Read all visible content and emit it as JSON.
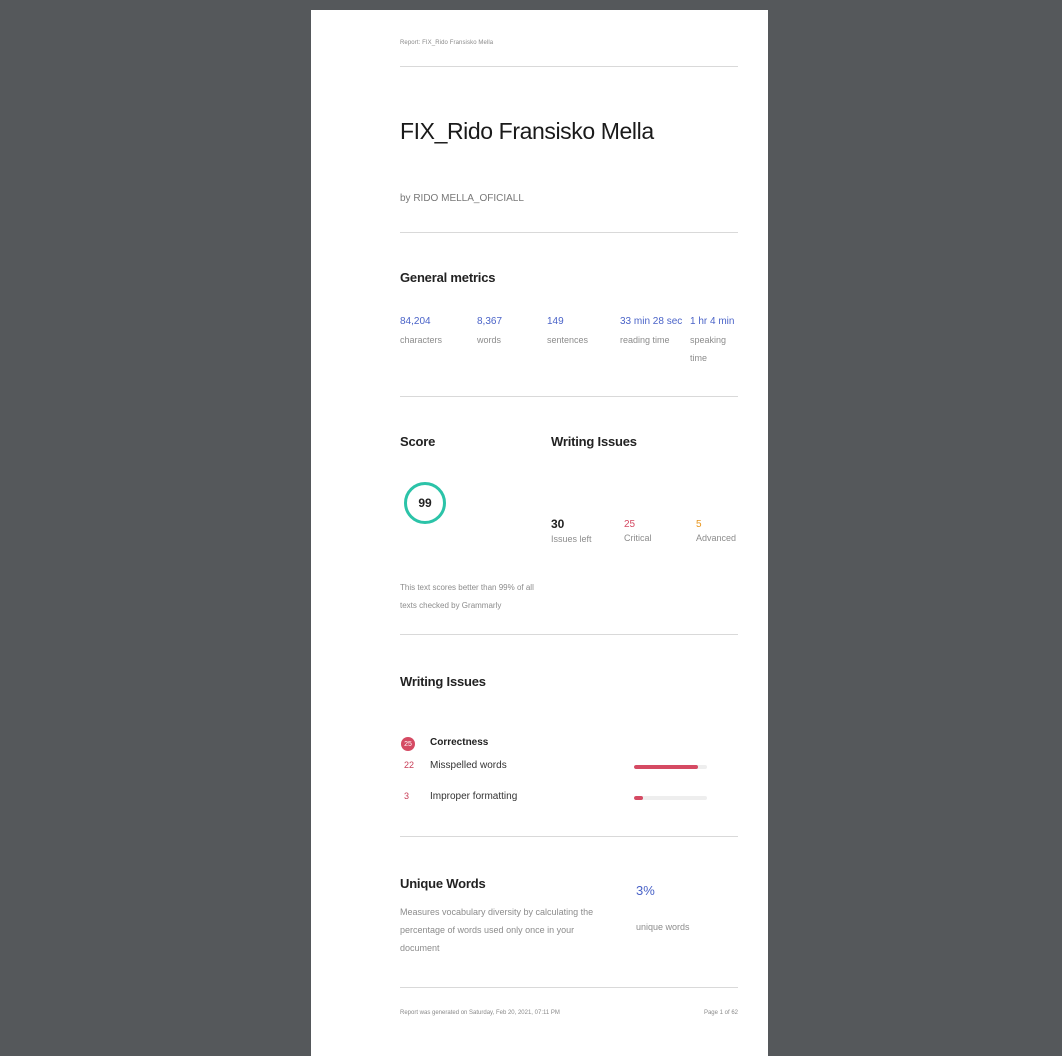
{
  "header": {
    "breadcrumb": "Report: FIX_Rido Fransisko Mella"
  },
  "document": {
    "title": "FIX_Rido Fransisko Mella",
    "author": "by RIDO MELLA_OFICIALL"
  },
  "general_metrics": {
    "heading": "General metrics",
    "items": [
      {
        "value": "84,204",
        "label": "characters"
      },
      {
        "value": "8,367",
        "label": "words"
      },
      {
        "value": "149",
        "label": "sentences"
      },
      {
        "value": "33 min 28 sec",
        "label": "reading time"
      },
      {
        "value": "1 hr 4 min",
        "label": "speaking time"
      }
    ]
  },
  "score": {
    "heading": "Score",
    "value": "99",
    "description": "This text scores better than 99% of all texts checked by Grammarly"
  },
  "writing_issues_summary": {
    "heading": "Writing Issues",
    "items": [
      {
        "value": "30",
        "label": "Issues left",
        "color": "#222222"
      },
      {
        "value": "25",
        "label": "Critical",
        "color": "#d54a63"
      },
      {
        "value": "5",
        "label": "Advanced",
        "color": "#e8961e"
      }
    ]
  },
  "writing_issues_detail": {
    "heading": "Writing Issues",
    "category": {
      "count": "25",
      "label": "Correctness"
    },
    "rows": [
      {
        "count": "22",
        "label": "Misspelled words",
        "fraction": 0.88
      },
      {
        "count": "3",
        "label": "Improper formatting",
        "fraction": 0.12
      }
    ]
  },
  "unique_words": {
    "heading": "Unique Words",
    "description": "Measures vocabulary diversity by calculating the percentage of words used only once in your document",
    "value": "3%",
    "label": "unique words"
  },
  "footer": {
    "generated": "Report was generated on Saturday, Feb 20, 2021, 07:11 PM",
    "page": "Page 1 of 62"
  },
  "colors": {
    "accent_blue": "#4a63c8",
    "score_ring": "#2bc3a8",
    "critical": "#d54a63",
    "advanced": "#e8961e",
    "background": "#55585b"
  }
}
